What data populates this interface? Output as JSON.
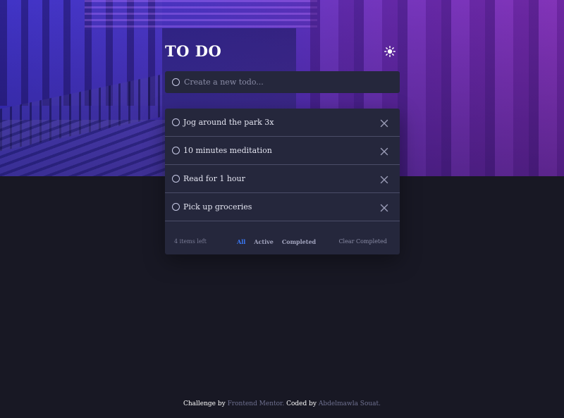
{
  "header": {
    "title": "TO DO",
    "theme_icon": "sun-icon"
  },
  "new_todo": {
    "placeholder": "Create a new todo...",
    "value": ""
  },
  "todos": [
    {
      "text": "Jog around the park 3x",
      "completed": false
    },
    {
      "text": "10 minutes meditation",
      "completed": false
    },
    {
      "text": "Read for 1 hour",
      "completed": false
    },
    {
      "text": "Pick up groceries",
      "completed": false
    }
  ],
  "footer": {
    "items_left": "4 items left",
    "filters": [
      "All",
      "Active",
      "Completed"
    ],
    "active_filter": "All",
    "clear_label": "Clear Completed"
  },
  "attribution": {
    "prefix": "Challenge by",
    "link1": "Frontend Mentor.",
    "middle": "Coded by",
    "link2": "Abdelmawla Souat."
  },
  "colors": {
    "background": "#181824",
    "card": "#25273c",
    "accent": "#3a7bfd",
    "text": "#e4e5f1"
  }
}
